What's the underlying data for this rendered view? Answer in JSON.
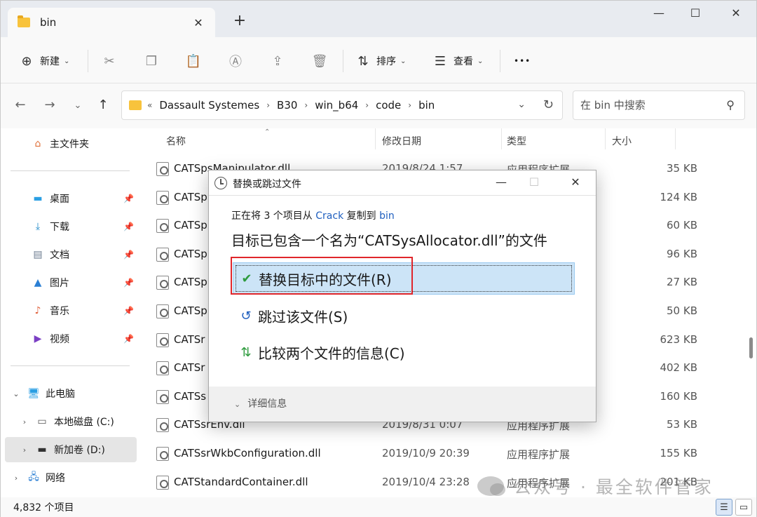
{
  "window": {
    "tab_title": "bin",
    "tab_close": "✕",
    "new_tab": "+",
    "controls": {
      "minimize": "—",
      "maximize": "☐",
      "close": "✕"
    }
  },
  "toolbar": {
    "new_label": "新建",
    "sort_label": "排序",
    "view_label": "查看",
    "more_label": "•••"
  },
  "address": {
    "chevron": "«",
    "segments": [
      "Dassault Systemes",
      "B30",
      "win_b64",
      "code",
      "bin"
    ],
    "search_placeholder": "在 bin 中搜索"
  },
  "sidebar": {
    "home": "主文件夹",
    "quick": [
      {
        "label": "桌面",
        "icon": "desktop-icon",
        "color": "#2b9fe3"
      },
      {
        "label": "下载",
        "icon": "download-icon",
        "color": "#1e88c8"
      },
      {
        "label": "文档",
        "icon": "document-icon",
        "color": "#6b7b8f"
      },
      {
        "label": "图片",
        "icon": "pictures-icon",
        "color": "#2b7fd4"
      },
      {
        "label": "音乐",
        "icon": "music-icon",
        "color": "#e0603a"
      },
      {
        "label": "视频",
        "icon": "video-icon",
        "color": "#7b3fc4"
      }
    ],
    "this_pc": "此电脑",
    "drives": [
      {
        "label": "本地磁盘 (C:)"
      },
      {
        "label": "新加卷 (D:)"
      }
    ],
    "network": "网络"
  },
  "columns": {
    "name": "名称",
    "date": "修改日期",
    "type": "类型",
    "size": "大小"
  },
  "files": [
    {
      "name": "CATSpsManipulator.dll",
      "date": "2019/8/24 1:57",
      "type": "应用程序扩展",
      "size": "35 KB"
    },
    {
      "name": "CATSp",
      "date": "",
      "type": "",
      "size": "124 KB"
    },
    {
      "name": "CATSp",
      "date": "",
      "type": "",
      "size": "60 KB"
    },
    {
      "name": "CATSp",
      "date": "",
      "type": "",
      "size": "96 KB"
    },
    {
      "name": "CATSp",
      "date": "",
      "type": "",
      "size": "27 KB"
    },
    {
      "name": "CATSp",
      "date": "",
      "type": "",
      "size": "50 KB"
    },
    {
      "name": "CATSr",
      "date": "",
      "type": "",
      "size": "623 KB"
    },
    {
      "name": "CATSr",
      "date": "",
      "type": "",
      "size": "402 KB"
    },
    {
      "name": "CATSs",
      "date": "",
      "type": "",
      "size": "160 KB"
    },
    {
      "name": "CATSsrEnv.dll",
      "date": "2019/8/31 0:07",
      "type": "应用程序扩展",
      "size": "53 KB"
    },
    {
      "name": "CATSsrWkbConfiguration.dll",
      "date": "2019/10/9 20:39",
      "type": "应用程序扩展",
      "size": "155 KB"
    },
    {
      "name": "CATStandardContainer.dll",
      "date": "2019/10/4 23:28",
      "type": "应用程序扩展",
      "size": "201 KB"
    }
  ],
  "status": {
    "count": "4,832 个项目"
  },
  "dialog": {
    "title": "替换或跳过文件",
    "line1_prefix": "正在将 3 个项目从 ",
    "line1_source": "Crack",
    "line1_mid": " 复制到 ",
    "line1_dest": "bin",
    "line2": "目标已包含一个名为“CATSysAllocator.dll”的文件",
    "options": [
      {
        "label": "替换目标中的文件(R)",
        "icon": "check-icon",
        "glyph": "✔",
        "color": "#2e9b3e"
      },
      {
        "label": "跳过该文件(S)",
        "icon": "skip-icon",
        "glyph": "↺",
        "color": "#1f5fbf"
      },
      {
        "label": "比较两个文件的信息(C)",
        "icon": "compare-icon",
        "glyph": "⇅",
        "color": "#2e9b3e"
      }
    ],
    "details": "详细信息"
  },
  "watermark": "公众号 · 最全软件管家",
  "colors": {
    "accent": "#0067c0",
    "highlight": "#cce4f7",
    "annotation_red": "#e0262b"
  }
}
